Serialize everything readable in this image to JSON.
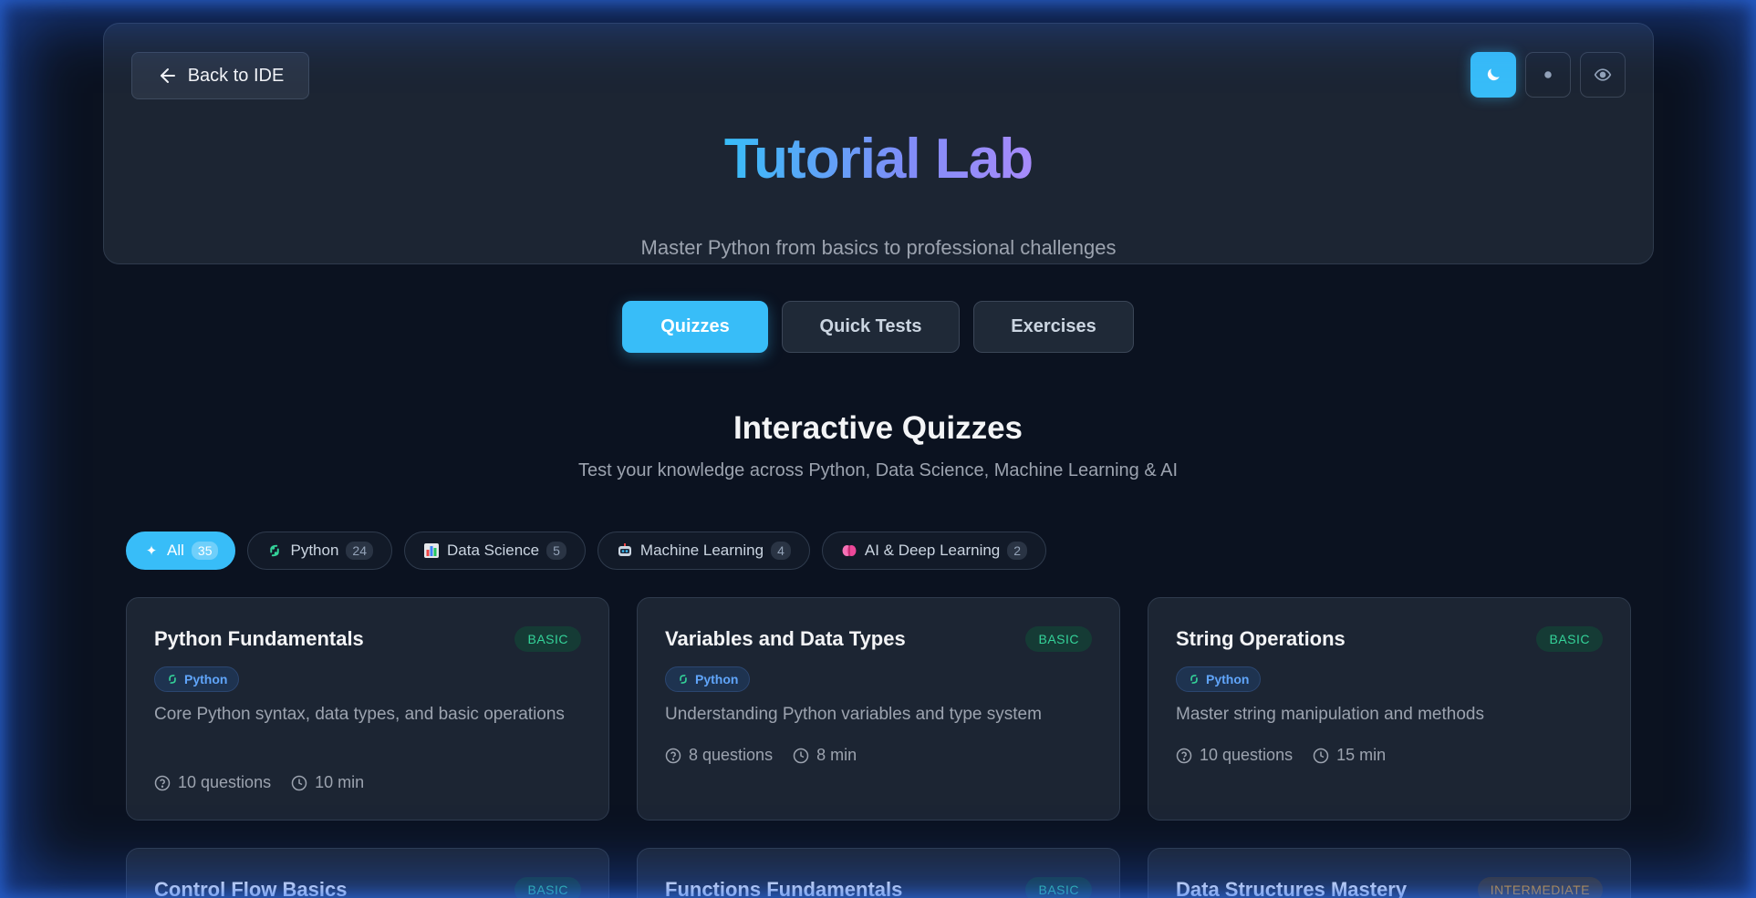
{
  "header": {
    "back_label": "Back to IDE",
    "title": "Tutorial Lab",
    "subtitle": "Master Python from basics to professional challenges",
    "theme_buttons": [
      {
        "icon": "moon-icon",
        "active": true
      },
      {
        "icon": "dot-icon",
        "active": false
      },
      {
        "icon": "eye-icon",
        "active": false
      }
    ]
  },
  "tabs": [
    {
      "label": "Quizzes",
      "active": true
    },
    {
      "label": "Quick Tests",
      "active": false
    },
    {
      "label": "Exercises",
      "active": false
    }
  ],
  "section": {
    "title": "Interactive Quizzes",
    "subtitle": "Test your knowledge across Python, Data Science, Machine Learning & AI"
  },
  "filters": [
    {
      "label": "All",
      "count": "35",
      "icon": "sparkle-icon",
      "active": true
    },
    {
      "label": "Python",
      "count": "24",
      "icon": "python-icon",
      "active": false
    },
    {
      "label": "Data Science",
      "count": "5",
      "icon": "bar-chart-icon",
      "active": false
    },
    {
      "label": "Machine Learning",
      "count": "4",
      "icon": "robot-icon",
      "active": false
    },
    {
      "label": "AI & Deep Learning",
      "count": "2",
      "icon": "brain-icon",
      "active": false
    }
  ],
  "cards": [
    {
      "title": "Python Fundamentals",
      "level": "BASIC",
      "category": "Python",
      "description": "Core Python syntax, data types, and basic operations",
      "questions": "10 questions",
      "time": "10 min"
    },
    {
      "title": "Variables and Data Types",
      "level": "BASIC",
      "category": "Python",
      "description": "Understanding Python variables and type system",
      "questions": "8 questions",
      "time": "8 min"
    },
    {
      "title": "String Operations",
      "level": "BASIC",
      "category": "Python",
      "description": "Master string manipulation and methods",
      "questions": "10 questions",
      "time": "15 min"
    },
    {
      "title": "Control Flow Basics",
      "level": "BASIC"
    },
    {
      "title": "Functions Fundamentals",
      "level": "BASIC"
    },
    {
      "title": "Data Structures Mastery",
      "level": "INTERMEDIATE"
    }
  ],
  "colors": {
    "accent": "#38bdf8",
    "background": "#0b1220",
    "card": "#1c2533",
    "basic": "#34d399",
    "intermediate": "#f59e0b"
  }
}
